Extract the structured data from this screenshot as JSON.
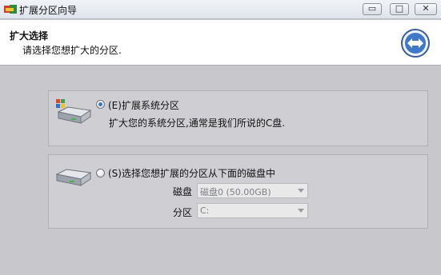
{
  "window": {
    "title": "扩展分区向导",
    "controls": {
      "minimize": "▭",
      "maximize": "□",
      "close": "✕"
    }
  },
  "header": {
    "title": "扩大选择",
    "subtitle": "请选择您想扩大的分区."
  },
  "options": [
    {
      "radio_label": "(E)扩展系统分区",
      "description": "扩大您的系统分区,通常是我们所说的C盘.",
      "selected": true
    },
    {
      "radio_label": "(S)选择您想扩展的分区从下面的磁盘中",
      "selected": false,
      "disk_label": "磁盘",
      "disk_value": "磁盘0 (50.00GB)",
      "partition_label": "分区",
      "partition_value": "C:"
    }
  ],
  "colors": {
    "accent": "#3a77c6",
    "background": "#c8c8cc",
    "header_bg": "#ffffff"
  },
  "icons": {
    "app": "app-icon",
    "nav": "back-forward-icon",
    "system_drive": "system-drive-icon",
    "drive": "drive-icon"
  }
}
